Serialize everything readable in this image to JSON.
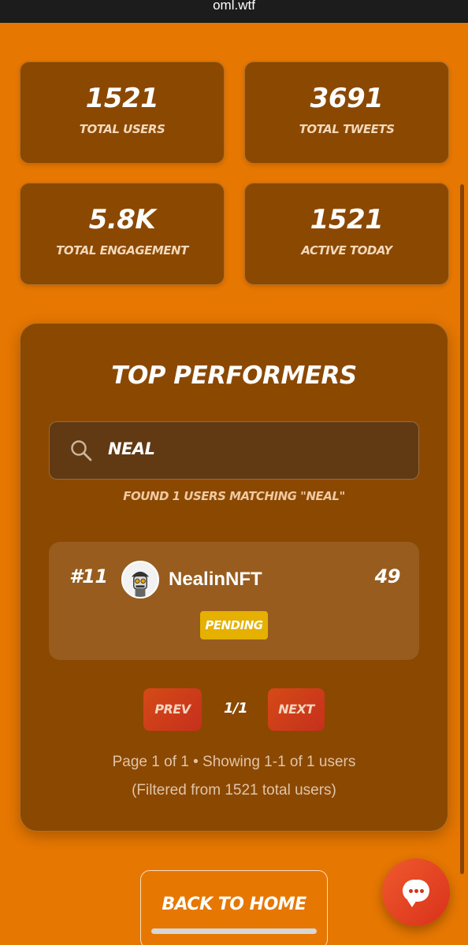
{
  "browser": {
    "url": "oml.wtf"
  },
  "stats": [
    {
      "value": "1521",
      "label": "TOTAL USERS"
    },
    {
      "value": "3691",
      "label": "TOTAL TWEETS"
    },
    {
      "value": "5.8K",
      "label": "TOTAL ENGAGEMENT"
    },
    {
      "value": "1521",
      "label": "ACTIVE TODAY"
    }
  ],
  "panel": {
    "title": "TOP PERFORMERS",
    "search": {
      "value": "NEAL",
      "icon": "search-icon"
    },
    "found_text": "FOUND 1 USERS MATCHING \"NEAL\"",
    "results": [
      {
        "rank": "#11",
        "username": "NealinNFT",
        "score": "49",
        "status": "PENDING",
        "avatar_icon": "avatar-icon"
      }
    ],
    "pagination": {
      "prev_label": "PREV",
      "next_label": "NEXT",
      "indicator": "1/1",
      "info_line1": "Page 1 of 1 • Showing 1-1 of 1 users",
      "info_line2": "(Filtered from 1521 total users)"
    }
  },
  "footer": {
    "back_home_label": "BACK TO HOME",
    "chat_icon": "chat-icon"
  },
  "colors": {
    "background": "#e67700",
    "card": "#8a4800",
    "badge": "#e6b000",
    "button": "#d44a16"
  }
}
